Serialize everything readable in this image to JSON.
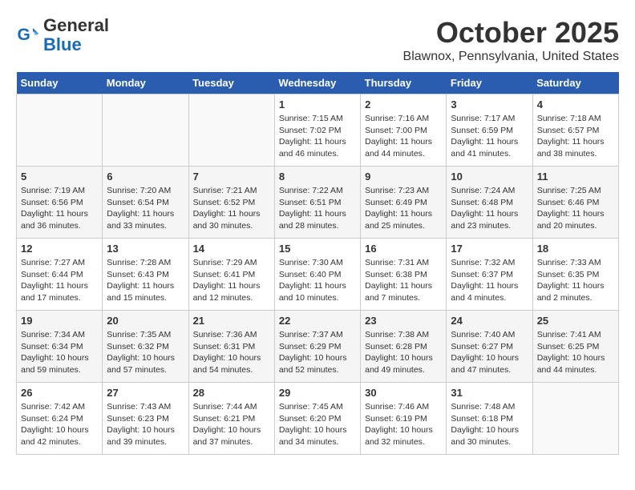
{
  "header": {
    "logo_general": "General",
    "logo_blue": "Blue",
    "month": "October 2025",
    "location": "Blawnox, Pennsylvania, United States"
  },
  "days_of_week": [
    "Sunday",
    "Monday",
    "Tuesday",
    "Wednesday",
    "Thursday",
    "Friday",
    "Saturday"
  ],
  "weeks": [
    [
      {
        "day": "",
        "info": ""
      },
      {
        "day": "",
        "info": ""
      },
      {
        "day": "",
        "info": ""
      },
      {
        "day": "1",
        "info": "Sunrise: 7:15 AM\nSunset: 7:02 PM\nDaylight: 11 hours\nand 46 minutes."
      },
      {
        "day": "2",
        "info": "Sunrise: 7:16 AM\nSunset: 7:00 PM\nDaylight: 11 hours\nand 44 minutes."
      },
      {
        "day": "3",
        "info": "Sunrise: 7:17 AM\nSunset: 6:59 PM\nDaylight: 11 hours\nand 41 minutes."
      },
      {
        "day": "4",
        "info": "Sunrise: 7:18 AM\nSunset: 6:57 PM\nDaylight: 11 hours\nand 38 minutes."
      }
    ],
    [
      {
        "day": "5",
        "info": "Sunrise: 7:19 AM\nSunset: 6:56 PM\nDaylight: 11 hours\nand 36 minutes."
      },
      {
        "day": "6",
        "info": "Sunrise: 7:20 AM\nSunset: 6:54 PM\nDaylight: 11 hours\nand 33 minutes."
      },
      {
        "day": "7",
        "info": "Sunrise: 7:21 AM\nSunset: 6:52 PM\nDaylight: 11 hours\nand 30 minutes."
      },
      {
        "day": "8",
        "info": "Sunrise: 7:22 AM\nSunset: 6:51 PM\nDaylight: 11 hours\nand 28 minutes."
      },
      {
        "day": "9",
        "info": "Sunrise: 7:23 AM\nSunset: 6:49 PM\nDaylight: 11 hours\nand 25 minutes."
      },
      {
        "day": "10",
        "info": "Sunrise: 7:24 AM\nSunset: 6:48 PM\nDaylight: 11 hours\nand 23 minutes."
      },
      {
        "day": "11",
        "info": "Sunrise: 7:25 AM\nSunset: 6:46 PM\nDaylight: 11 hours\nand 20 minutes."
      }
    ],
    [
      {
        "day": "12",
        "info": "Sunrise: 7:27 AM\nSunset: 6:44 PM\nDaylight: 11 hours\nand 17 minutes."
      },
      {
        "day": "13",
        "info": "Sunrise: 7:28 AM\nSunset: 6:43 PM\nDaylight: 11 hours\nand 15 minutes."
      },
      {
        "day": "14",
        "info": "Sunrise: 7:29 AM\nSunset: 6:41 PM\nDaylight: 11 hours\nand 12 minutes."
      },
      {
        "day": "15",
        "info": "Sunrise: 7:30 AM\nSunset: 6:40 PM\nDaylight: 11 hours\nand 10 minutes."
      },
      {
        "day": "16",
        "info": "Sunrise: 7:31 AM\nSunset: 6:38 PM\nDaylight: 11 hours\nand 7 minutes."
      },
      {
        "day": "17",
        "info": "Sunrise: 7:32 AM\nSunset: 6:37 PM\nDaylight: 11 hours\nand 4 minutes."
      },
      {
        "day": "18",
        "info": "Sunrise: 7:33 AM\nSunset: 6:35 PM\nDaylight: 11 hours\nand 2 minutes."
      }
    ],
    [
      {
        "day": "19",
        "info": "Sunrise: 7:34 AM\nSunset: 6:34 PM\nDaylight: 10 hours\nand 59 minutes."
      },
      {
        "day": "20",
        "info": "Sunrise: 7:35 AM\nSunset: 6:32 PM\nDaylight: 10 hours\nand 57 minutes."
      },
      {
        "day": "21",
        "info": "Sunrise: 7:36 AM\nSunset: 6:31 PM\nDaylight: 10 hours\nand 54 minutes."
      },
      {
        "day": "22",
        "info": "Sunrise: 7:37 AM\nSunset: 6:29 PM\nDaylight: 10 hours\nand 52 minutes."
      },
      {
        "day": "23",
        "info": "Sunrise: 7:38 AM\nSunset: 6:28 PM\nDaylight: 10 hours\nand 49 minutes."
      },
      {
        "day": "24",
        "info": "Sunrise: 7:40 AM\nSunset: 6:27 PM\nDaylight: 10 hours\nand 47 minutes."
      },
      {
        "day": "25",
        "info": "Sunrise: 7:41 AM\nSunset: 6:25 PM\nDaylight: 10 hours\nand 44 minutes."
      }
    ],
    [
      {
        "day": "26",
        "info": "Sunrise: 7:42 AM\nSunset: 6:24 PM\nDaylight: 10 hours\nand 42 minutes."
      },
      {
        "day": "27",
        "info": "Sunrise: 7:43 AM\nSunset: 6:23 PM\nDaylight: 10 hours\nand 39 minutes."
      },
      {
        "day": "28",
        "info": "Sunrise: 7:44 AM\nSunset: 6:21 PM\nDaylight: 10 hours\nand 37 minutes."
      },
      {
        "day": "29",
        "info": "Sunrise: 7:45 AM\nSunset: 6:20 PM\nDaylight: 10 hours\nand 34 minutes."
      },
      {
        "day": "30",
        "info": "Sunrise: 7:46 AM\nSunset: 6:19 PM\nDaylight: 10 hours\nand 32 minutes."
      },
      {
        "day": "31",
        "info": "Sunrise: 7:48 AM\nSunset: 6:18 PM\nDaylight: 10 hours\nand 30 minutes."
      },
      {
        "day": "",
        "info": ""
      }
    ]
  ]
}
